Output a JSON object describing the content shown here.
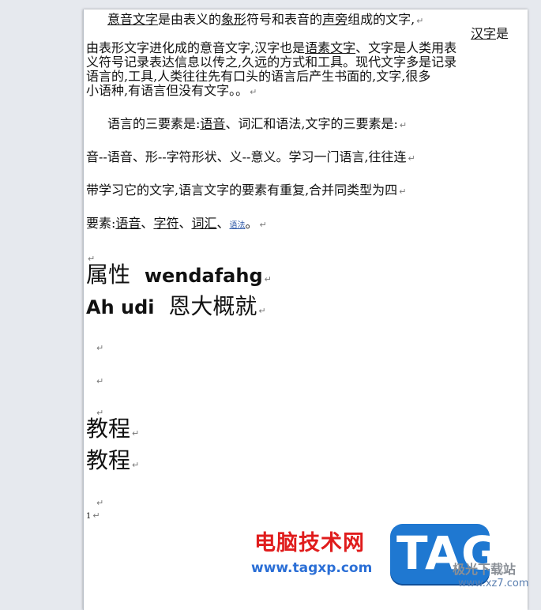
{
  "document": {
    "p1": {
      "t1": "意音文字",
      "t2": "是由表义的",
      "t3": "象形",
      "t4": "符号和表音的",
      "t5": "声旁",
      "t6": "组成的文字,",
      "t7": "汉字",
      "t8": "是",
      "l2a": "由表形文字进化成的意音文字,汉字也是",
      "l2b": "语素文字",
      "l2c": "、文字是人类用表",
      "l3": "义符号记录表达信息以传之,久远的方式和工具。现代文字多是记录",
      "l4": "语言的,工具,人类往往先有口头的语言后产生书面的,文字,很多",
      "l5": "小语种,有语言但没有文字。。"
    },
    "p2": {
      "l1a": "语言的三要素是:",
      "l1b": "语音",
      "l1c": "、词汇和语法,文字的三要素是:",
      "l2": "音--语音、形--字符形状、义--意义。学习一门语言,往往连",
      "l3": "带学习它的文字,语言文字的要素有重复,合并同类型为四",
      "l4a": "要素:",
      "l4b": "语音",
      "l4c": "、",
      "l4d": "字符",
      "l4e": "、",
      "l4f": "词汇",
      "l4g": "、",
      "l4h": "语法",
      "l4i": "。"
    },
    "big1a": "属性",
    "big1b": "wendafahg",
    "big2a": "Ah udi",
    "big2b": "恩大概就",
    "tut1": "教程",
    "tut2": "教程",
    "page_num": "1",
    "mark": "↵"
  },
  "watermark": {
    "cn_name": "电脑技术网",
    "url": "www.tagxp.com",
    "badge": "TAG",
    "site_cn": "极光下载站",
    "site_url": "www.xz7.com"
  }
}
